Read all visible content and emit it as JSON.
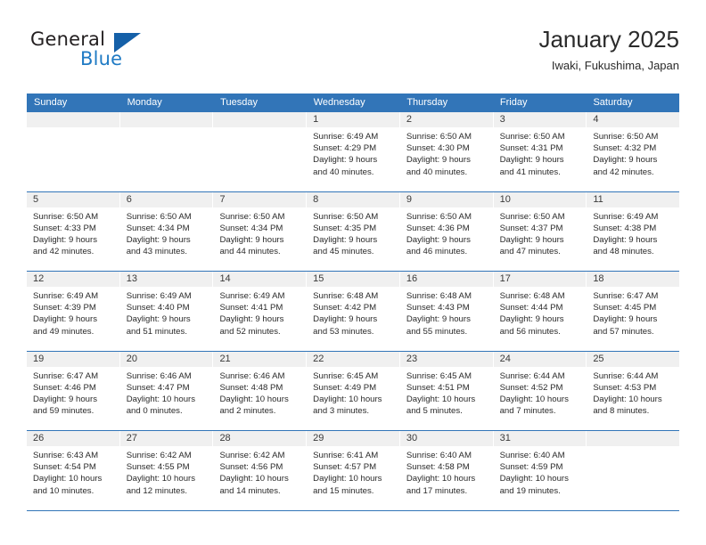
{
  "brand": {
    "name_part1": "General",
    "name_part2": "Blue",
    "triangle_color": "#1560a8",
    "blue_color": "#1f7ac4"
  },
  "header": {
    "title": "January 2025",
    "subtitle": "Iwaki, Fukushima, Japan",
    "header_bg": "#3275b8",
    "header_text_color": "#ffffff"
  },
  "calendar": {
    "weekday_headers": [
      "Sunday",
      "Monday",
      "Tuesday",
      "Wednesday",
      "Thursday",
      "Friday",
      "Saturday"
    ],
    "weeks": [
      [
        {
          "day": "",
          "empty": true
        },
        {
          "day": "",
          "empty": true
        },
        {
          "day": "",
          "empty": true
        },
        {
          "day": "1",
          "sunrise": "Sunrise: 6:49 AM",
          "sunset": "Sunset: 4:29 PM",
          "daylight1": "Daylight: 9 hours",
          "daylight2": "and 40 minutes."
        },
        {
          "day": "2",
          "sunrise": "Sunrise: 6:50 AM",
          "sunset": "Sunset: 4:30 PM",
          "daylight1": "Daylight: 9 hours",
          "daylight2": "and 40 minutes."
        },
        {
          "day": "3",
          "sunrise": "Sunrise: 6:50 AM",
          "sunset": "Sunset: 4:31 PM",
          "daylight1": "Daylight: 9 hours",
          "daylight2": "and 41 minutes."
        },
        {
          "day": "4",
          "sunrise": "Sunrise: 6:50 AM",
          "sunset": "Sunset: 4:32 PM",
          "daylight1": "Daylight: 9 hours",
          "daylight2": "and 42 minutes."
        }
      ],
      [
        {
          "day": "5",
          "sunrise": "Sunrise: 6:50 AM",
          "sunset": "Sunset: 4:33 PM",
          "daylight1": "Daylight: 9 hours",
          "daylight2": "and 42 minutes."
        },
        {
          "day": "6",
          "sunrise": "Sunrise: 6:50 AM",
          "sunset": "Sunset: 4:34 PM",
          "daylight1": "Daylight: 9 hours",
          "daylight2": "and 43 minutes."
        },
        {
          "day": "7",
          "sunrise": "Sunrise: 6:50 AM",
          "sunset": "Sunset: 4:34 PM",
          "daylight1": "Daylight: 9 hours",
          "daylight2": "and 44 minutes."
        },
        {
          "day": "8",
          "sunrise": "Sunrise: 6:50 AM",
          "sunset": "Sunset: 4:35 PM",
          "daylight1": "Daylight: 9 hours",
          "daylight2": "and 45 minutes."
        },
        {
          "day": "9",
          "sunrise": "Sunrise: 6:50 AM",
          "sunset": "Sunset: 4:36 PM",
          "daylight1": "Daylight: 9 hours",
          "daylight2": "and 46 minutes."
        },
        {
          "day": "10",
          "sunrise": "Sunrise: 6:50 AM",
          "sunset": "Sunset: 4:37 PM",
          "daylight1": "Daylight: 9 hours",
          "daylight2": "and 47 minutes."
        },
        {
          "day": "11",
          "sunrise": "Sunrise: 6:49 AM",
          "sunset": "Sunset: 4:38 PM",
          "daylight1": "Daylight: 9 hours",
          "daylight2": "and 48 minutes."
        }
      ],
      [
        {
          "day": "12",
          "sunrise": "Sunrise: 6:49 AM",
          "sunset": "Sunset: 4:39 PM",
          "daylight1": "Daylight: 9 hours",
          "daylight2": "and 49 minutes."
        },
        {
          "day": "13",
          "sunrise": "Sunrise: 6:49 AM",
          "sunset": "Sunset: 4:40 PM",
          "daylight1": "Daylight: 9 hours",
          "daylight2": "and 51 minutes."
        },
        {
          "day": "14",
          "sunrise": "Sunrise: 6:49 AM",
          "sunset": "Sunset: 4:41 PM",
          "daylight1": "Daylight: 9 hours",
          "daylight2": "and 52 minutes."
        },
        {
          "day": "15",
          "sunrise": "Sunrise: 6:48 AM",
          "sunset": "Sunset: 4:42 PM",
          "daylight1": "Daylight: 9 hours",
          "daylight2": "and 53 minutes."
        },
        {
          "day": "16",
          "sunrise": "Sunrise: 6:48 AM",
          "sunset": "Sunset: 4:43 PM",
          "daylight1": "Daylight: 9 hours",
          "daylight2": "and 55 minutes."
        },
        {
          "day": "17",
          "sunrise": "Sunrise: 6:48 AM",
          "sunset": "Sunset: 4:44 PM",
          "daylight1": "Daylight: 9 hours",
          "daylight2": "and 56 minutes."
        },
        {
          "day": "18",
          "sunrise": "Sunrise: 6:47 AM",
          "sunset": "Sunset: 4:45 PM",
          "daylight1": "Daylight: 9 hours",
          "daylight2": "and 57 minutes."
        }
      ],
      [
        {
          "day": "19",
          "sunrise": "Sunrise: 6:47 AM",
          "sunset": "Sunset: 4:46 PM",
          "daylight1": "Daylight: 9 hours",
          "daylight2": "and 59 minutes."
        },
        {
          "day": "20",
          "sunrise": "Sunrise: 6:46 AM",
          "sunset": "Sunset: 4:47 PM",
          "daylight1": "Daylight: 10 hours",
          "daylight2": "and 0 minutes."
        },
        {
          "day": "21",
          "sunrise": "Sunrise: 6:46 AM",
          "sunset": "Sunset: 4:48 PM",
          "daylight1": "Daylight: 10 hours",
          "daylight2": "and 2 minutes."
        },
        {
          "day": "22",
          "sunrise": "Sunrise: 6:45 AM",
          "sunset": "Sunset: 4:49 PM",
          "daylight1": "Daylight: 10 hours",
          "daylight2": "and 3 minutes."
        },
        {
          "day": "23",
          "sunrise": "Sunrise: 6:45 AM",
          "sunset": "Sunset: 4:51 PM",
          "daylight1": "Daylight: 10 hours",
          "daylight2": "and 5 minutes."
        },
        {
          "day": "24",
          "sunrise": "Sunrise: 6:44 AM",
          "sunset": "Sunset: 4:52 PM",
          "daylight1": "Daylight: 10 hours",
          "daylight2": "and 7 minutes."
        },
        {
          "day": "25",
          "sunrise": "Sunrise: 6:44 AM",
          "sunset": "Sunset: 4:53 PM",
          "daylight1": "Daylight: 10 hours",
          "daylight2": "and 8 minutes."
        }
      ],
      [
        {
          "day": "26",
          "sunrise": "Sunrise: 6:43 AM",
          "sunset": "Sunset: 4:54 PM",
          "daylight1": "Daylight: 10 hours",
          "daylight2": "and 10 minutes."
        },
        {
          "day": "27",
          "sunrise": "Sunrise: 6:42 AM",
          "sunset": "Sunset: 4:55 PM",
          "daylight1": "Daylight: 10 hours",
          "daylight2": "and 12 minutes."
        },
        {
          "day": "28",
          "sunrise": "Sunrise: 6:42 AM",
          "sunset": "Sunset: 4:56 PM",
          "daylight1": "Daylight: 10 hours",
          "daylight2": "and 14 minutes."
        },
        {
          "day": "29",
          "sunrise": "Sunrise: 6:41 AM",
          "sunset": "Sunset: 4:57 PM",
          "daylight1": "Daylight: 10 hours",
          "daylight2": "and 15 minutes."
        },
        {
          "day": "30",
          "sunrise": "Sunrise: 6:40 AM",
          "sunset": "Sunset: 4:58 PM",
          "daylight1": "Daylight: 10 hours",
          "daylight2": "and 17 minutes."
        },
        {
          "day": "31",
          "sunrise": "Sunrise: 6:40 AM",
          "sunset": "Sunset: 4:59 PM",
          "daylight1": "Daylight: 10 hours",
          "daylight2": "and 19 minutes."
        },
        {
          "day": "",
          "empty": true
        }
      ]
    ]
  }
}
